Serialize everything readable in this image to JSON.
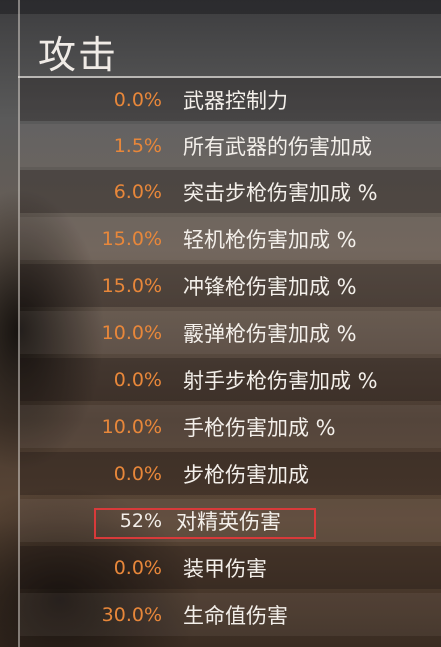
{
  "section": {
    "title": "攻击"
  },
  "stats": [
    {
      "value": "0.0%",
      "label": "武器控制力"
    },
    {
      "value": "1.5%",
      "label": "所有武器的伤害加成"
    },
    {
      "value": "6.0%",
      "label": "突击步枪伤害加成 %"
    },
    {
      "value": "15.0%",
      "label": "轻机枪伤害加成 %"
    },
    {
      "value": "15.0%",
      "label": "冲锋枪伤害加成 %"
    },
    {
      "value": "10.0%",
      "label": "霰弹枪伤害加成 %"
    },
    {
      "value": "0.0%",
      "label": "射手步枪伤害加成 %"
    },
    {
      "value": "10.0%",
      "label": "手枪伤害加成 %"
    },
    {
      "value": "0.0%",
      "label": "步枪伤害加成"
    },
    {
      "value": "52%",
      "label": "对精英伤害",
      "highlighted": true
    },
    {
      "value": "0.0%",
      "label": "装甲伤害"
    },
    {
      "value": "30.0%",
      "label": "生命值伤害"
    }
  ],
  "colors": {
    "value": "#e8873a",
    "label": "#f3efea",
    "highlight_border": "#d83a3a"
  }
}
